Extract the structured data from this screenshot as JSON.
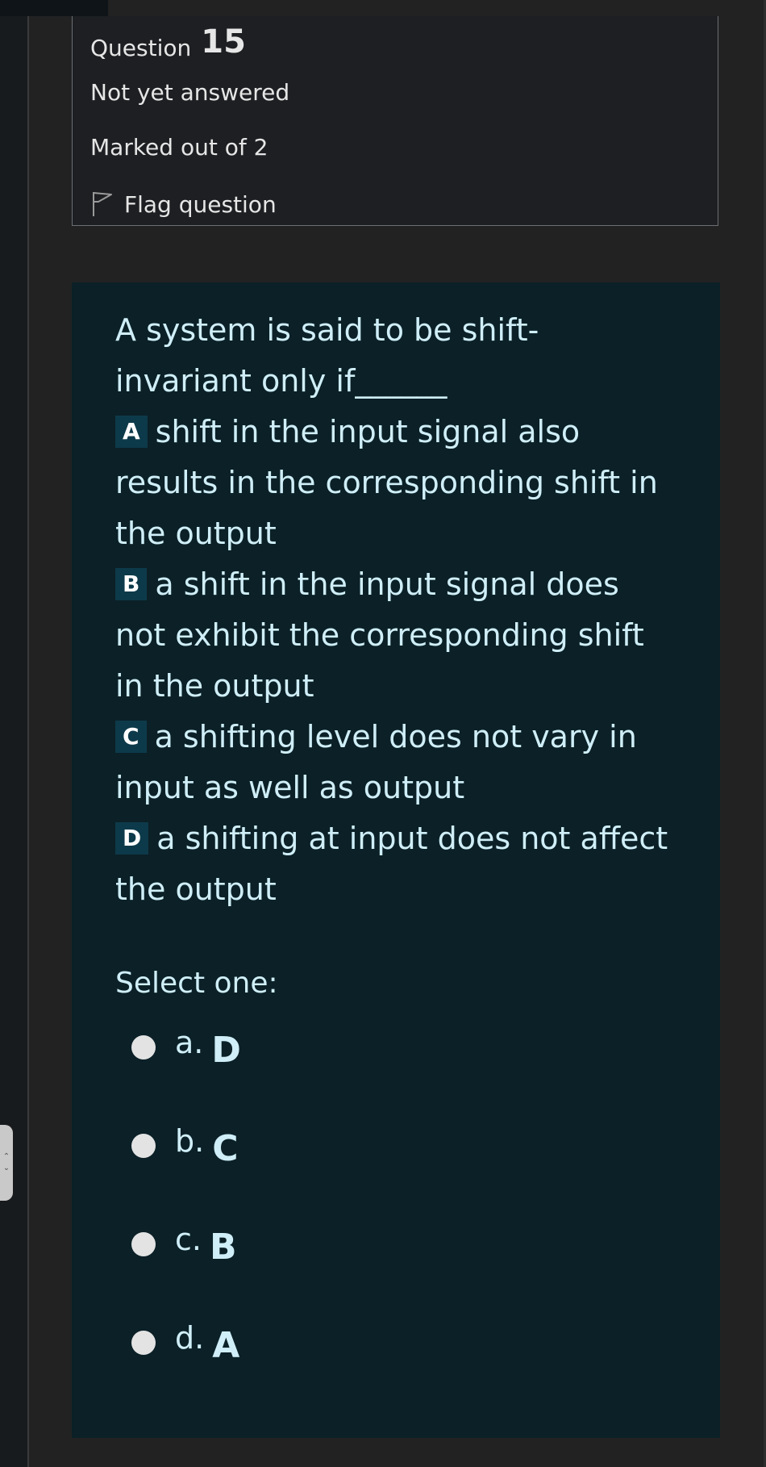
{
  "info": {
    "question_label": "Question",
    "question_number": "15",
    "status": "Not yet answered",
    "marks": "Marked out of 2",
    "flag_label": "Flag question"
  },
  "question": {
    "stem": "A system is said to be shift-invariant only if______",
    "options": [
      {
        "badge": "A",
        "text": "shift in the input signal also results in the corresponding shift in the output"
      },
      {
        "badge": "B",
        "text": "a shift in the input signal does not exhibit the corresponding shift in the output"
      },
      {
        "badge": "C",
        "text": "a shifting level does not vary in input as well as output"
      },
      {
        "badge": "D",
        "text": "a shifting at input does not affect the output"
      }
    ]
  },
  "select_label": "Select one:",
  "answers": [
    {
      "letter": "a.",
      "value": "D"
    },
    {
      "letter": "b.",
      "value": "C"
    },
    {
      "letter": "c.",
      "value": "B"
    },
    {
      "letter": "d.",
      "value": "A"
    }
  ],
  "colors": {
    "card_background": "#0b2027",
    "text_accent": "#cfeef7",
    "badge_background": "#0d3a4a"
  },
  "icons": {
    "flag": "flag-icon",
    "side_handle": "chevron-up-down-icon"
  }
}
